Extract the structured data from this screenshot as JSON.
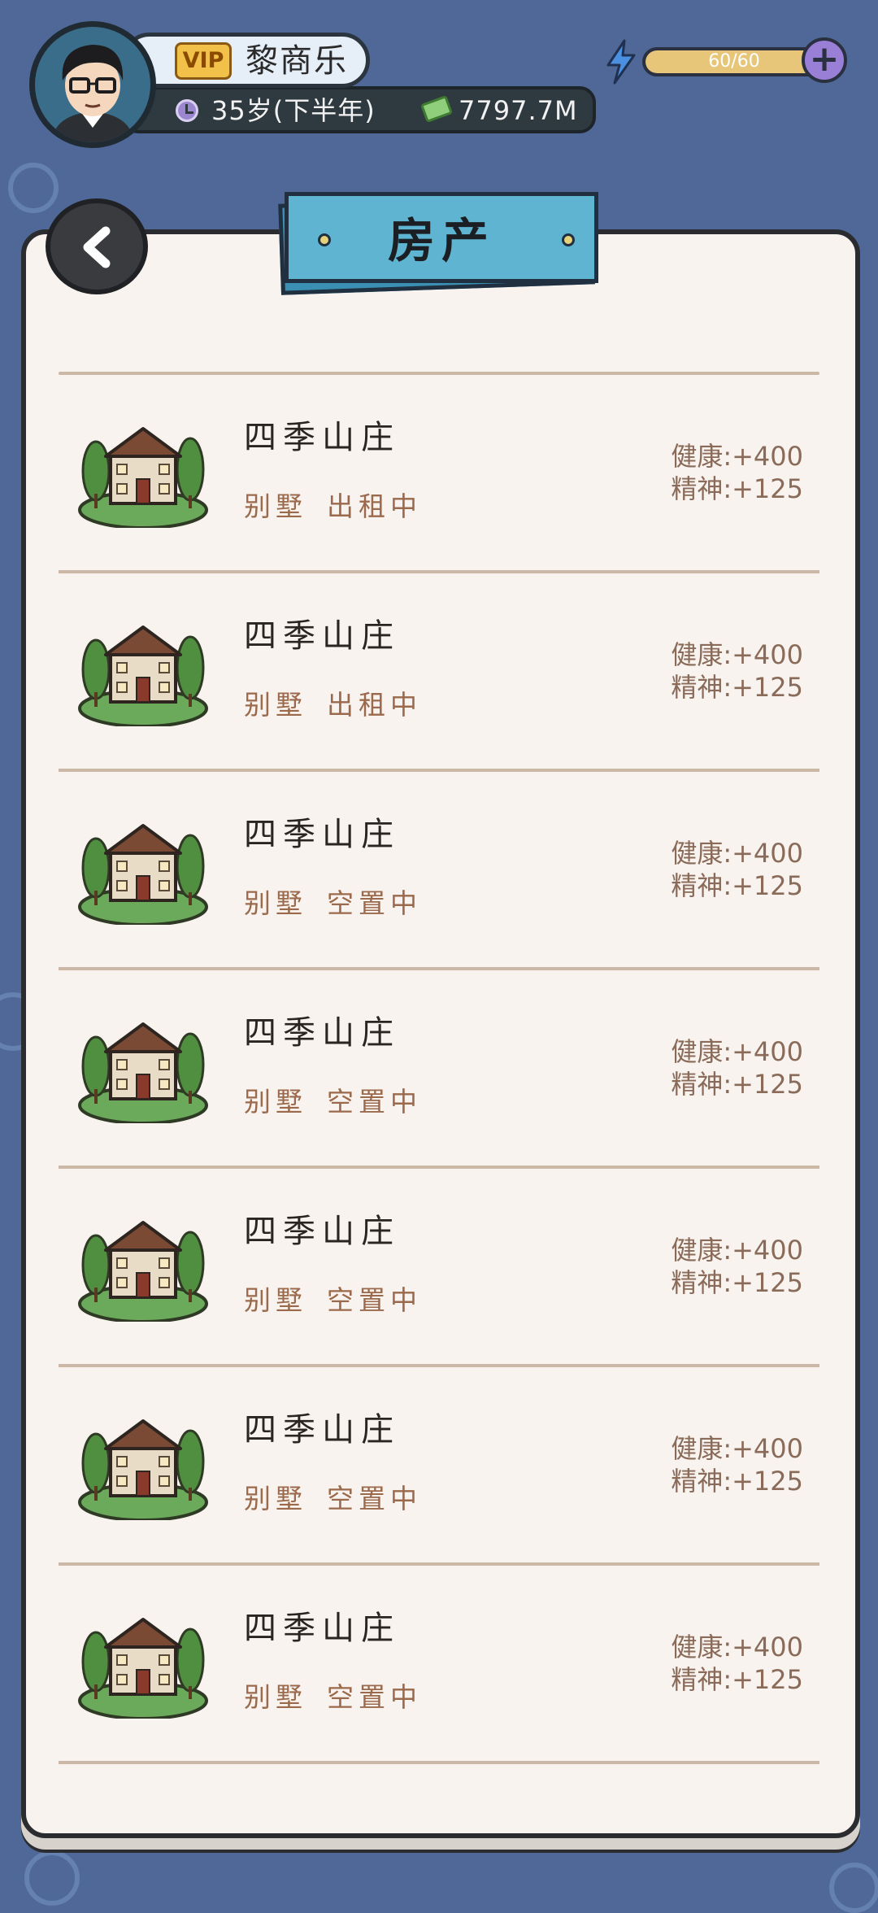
{
  "player": {
    "vip_label": "VIP",
    "name": "黎商乐",
    "age": "35岁(下半年)",
    "money": "7797.7M"
  },
  "energy": {
    "label": "60/60",
    "fraction": 1.0
  },
  "page": {
    "title": "房产"
  },
  "properties": [
    {
      "name": "四季山庄",
      "type": "别墅",
      "status": "出租中",
      "health": "健康:+400",
      "spirit": "精神:+125"
    },
    {
      "name": "四季山庄",
      "type": "别墅",
      "status": "出租中",
      "health": "健康:+400",
      "spirit": "精神:+125"
    },
    {
      "name": "四季山庄",
      "type": "别墅",
      "status": "空置中",
      "health": "健康:+400",
      "spirit": "精神:+125"
    },
    {
      "name": "四季山庄",
      "type": "别墅",
      "status": "空置中",
      "health": "健康:+400",
      "spirit": "精神:+125"
    },
    {
      "name": "四季山庄",
      "type": "别墅",
      "status": "空置中",
      "health": "健康:+400",
      "spirit": "精神:+125"
    },
    {
      "name": "四季山庄",
      "type": "别墅",
      "status": "空置中",
      "health": "健康:+400",
      "spirit": "精神:+125"
    },
    {
      "name": "四季山庄",
      "type": "别墅",
      "status": "空置中",
      "health": "健康:+400",
      "spirit": "精神:+125"
    }
  ],
  "icons": {
    "avatar": "avatar-portrait",
    "clock": "clock-icon",
    "money": "money-icon",
    "energy": "lightning-icon",
    "plus": "plus-icon",
    "back": "chevron-left-icon",
    "property": "villa-house-icon"
  },
  "colors": {
    "background": "#4f6898",
    "paper": "#f8f3ef",
    "banner": "#5eb4d1",
    "status_text": "#9b6a4c",
    "energy_fill": "#e7c679",
    "vip": "#f1c14a"
  }
}
